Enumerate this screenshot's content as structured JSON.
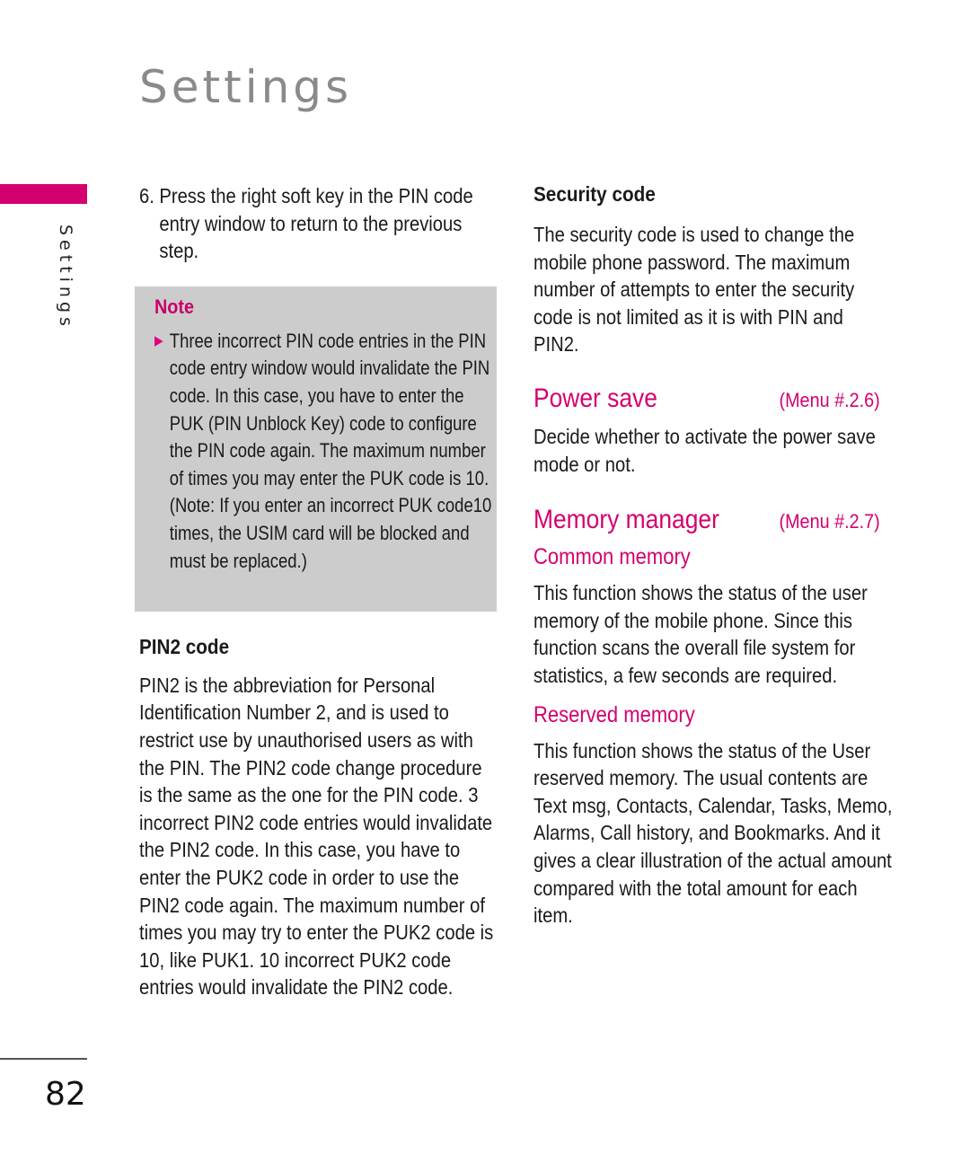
{
  "page": {
    "title": "Settings",
    "side_tab_label": "Settings",
    "page_number": "82",
    "accent_color": "#d4006f",
    "note_bg_color": "#cccccc"
  },
  "left_column": {
    "step": {
      "number": "6.",
      "text": "Press the right soft key in the PIN code entry window to return to the previous step."
    },
    "note": {
      "title": "Note",
      "bullet_icon": "triangle-right-icon",
      "text": "Three incorrect PIN code entries in the PIN code entry window would invalidate the PIN code. In this case, you have to enter the PUK (PIN Unblock Key) code to configure the PIN code again. The maximum number of times you may enter the PUK code is 10. (Note: If you enter an incorrect PUK code10 times, the USIM card will be blocked and must be replaced.)"
    },
    "pin2": {
      "heading": "PIN2 code",
      "text": "PIN2 is the abbreviation for Personal Identification Number 2, and is used to restrict use by unauthorised users as with the PIN. The PIN2 code change procedure is the same as the one for the PIN code. 3 incorrect PIN2 code entries would invalidate the PIN2 code. In this case, you have to enter the PUK2 code in order to use the PIN2 code again. The maximum number of times you may try to enter the PUK2 code is 10, like PUK1. 10 incorrect PUK2 code entries would invalidate the PIN2 code."
    }
  },
  "right_column": {
    "security": {
      "heading": "Security code",
      "text": "The security code is used to change the mobile phone password. The maximum number of attempts to enter the security code is not limited as it is with PIN and PIN2."
    },
    "power_save": {
      "title": "Power save",
      "menu_ref": "(Menu #.2.6)",
      "text": "Decide whether to activate the power save mode or not."
    },
    "memory_manager": {
      "title": "Memory manager",
      "menu_ref": "(Menu #.2.7)",
      "common": {
        "heading": "Common memory",
        "text": "This function shows the status of the user memory of the mobile phone. Since this function scans the overall file system for statistics, a few seconds are required."
      },
      "reserved": {
        "heading": "Reserved memory",
        "text": "This function shows the status of the User reserved memory. The usual contents are Text msg, Contacts, Calendar, Tasks, Memo, Alarms, Call history, and Bookmarks. And it gives a clear illustration of the actual amount compared with the total amount for each item."
      }
    }
  }
}
